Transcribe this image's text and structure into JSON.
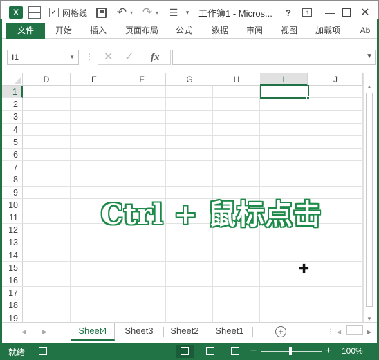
{
  "titlebar": {
    "gridlines_check": "✓",
    "gridlines_label": "网格线",
    "title": "工作簿1 - Micros...",
    "help": "?",
    "minimize": "—",
    "close": "✕"
  },
  "ribbon": {
    "tabs": [
      "文件",
      "开始",
      "插入",
      "页面布局",
      "公式",
      "数据",
      "审阅",
      "视图",
      "加载项",
      "Ab"
    ]
  },
  "formula_bar": {
    "namebox": "I1",
    "fx": "fx",
    "cancel": "✕",
    "enter": "✓"
  },
  "grid": {
    "columns": [
      "D",
      "E",
      "F",
      "G",
      "H",
      "I",
      "J"
    ],
    "selected_column": "I",
    "rows": [
      "1",
      "2",
      "3",
      "4",
      "5",
      "6",
      "7",
      "8",
      "9",
      "10",
      "11",
      "12",
      "13",
      "14",
      "15",
      "16",
      "17",
      "18",
      "19"
    ],
    "selected_row": "1",
    "active_cell": "I1"
  },
  "overlay": {
    "text": "Ctrl + 鼠标点击"
  },
  "sheets": {
    "tabs": [
      "Sheet4",
      "Sheet3",
      "Sheet2",
      "Sheet1"
    ],
    "active": "Sheet4",
    "add": "+"
  },
  "status": {
    "ready": "就绪",
    "zoom_minus": "−",
    "zoom_plus": "+",
    "zoom": "100%"
  },
  "colors": {
    "accent": "#217346",
    "selection": "#217346"
  }
}
